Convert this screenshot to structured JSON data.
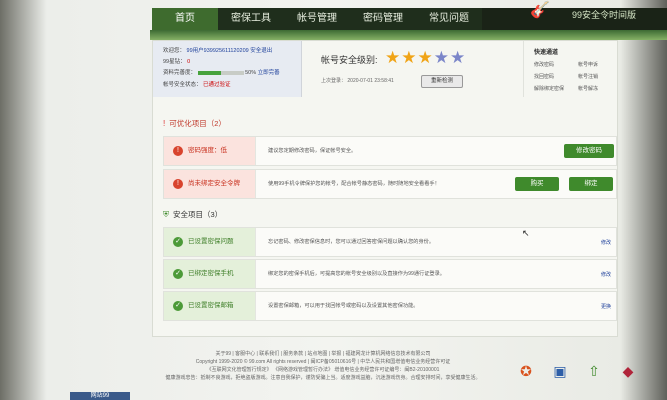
{
  "nav": {
    "items": [
      "首页",
      "密保工具",
      "帐号管理",
      "密码管理",
      "常见问题"
    ],
    "active_index": 0,
    "logo_text": "99安全令时间版"
  },
  "account": {
    "id_label": "欢迎您：",
    "id_value": "99用户939925611120209",
    "id_suffix": "安全退出",
    "points_label": "99星钻：",
    "points_value": "0",
    "completeness_label": "资料完善度：",
    "completeness_percent": "50%",
    "completeness_fraction": 0.5,
    "completeness_link": "立即完善",
    "security_label": "帐号安全状态：",
    "security_value": "已通过验证"
  },
  "security_level": {
    "title": "帐号安全级别:",
    "stars_filled": 3,
    "stars_total": 5,
    "last_login": "上次登录： 2020-07-01 23:58:41",
    "refresh_button": "重新检测"
  },
  "quick_menu": {
    "title": "快速通道",
    "items": [
      "修改密码",
      "帐号申诉",
      "找回密码",
      "帐号注销",
      "解除绑定密保",
      "帐号解冻"
    ]
  },
  "optimize_section": {
    "title": "可优化项目（2）",
    "items": [
      {
        "tag": "密码强度：低",
        "desc": "建议您定期修改密码，保证帐号安全。",
        "buttons": [
          "修改密码"
        ]
      },
      {
        "tag": "尚未绑定安全令牌",
        "desc": "使用99手机令牌保护您的帐号，配合帐号静态密码，随时随地安全看看手！",
        "buttons": [
          "购买",
          "绑定"
        ]
      }
    ]
  },
  "safe_section": {
    "title": "安全项目（3）",
    "items": [
      {
        "tag": "已设置密保问题",
        "desc": "忘记密码、修改密保信息时，您可以通过回答密保问题以确认您的身份。",
        "action": "修改"
      },
      {
        "tag": "已绑定密保手机",
        "desc": "绑定您的密保手机后，可提高您的帐号安全级别以及直接作为99通行证登录。",
        "action": "修改"
      },
      {
        "tag": "已设置密保邮箱",
        "desc": "设置密保邮箱，可以用于找回帐号或密码以及设置其他密保功能。",
        "action": "更换"
      }
    ]
  },
  "footer": {
    "lines": [
      "关于99 | 客服中心 | 联系我们 | 服务条款 | 站点地图 | 举报 | 福建网龙计算机网络信息技术有限公司",
      "Copyright 1999-2020 © 99.com All rights reserved | 闽ICP备05010616号 | 中华人民共和国增值电信业务经营许可证",
      "《互联网文化管理暂行规定》 《网络游戏管理暂行办法》 增值电信业务经营许可证编号：闽B2-20100001",
      "健康游戏忠告：抵制不良游戏，拒绝盗版游戏。注意自我保护，谨防受骗上当。适度游戏益脑，沉迷游戏伤身。合理安排时间，享受健康生活。"
    ],
    "badges": [
      "诚信认证",
      "可信网站",
      "安全认证",
      "18+"
    ]
  },
  "bottom_tab": "网站99"
}
